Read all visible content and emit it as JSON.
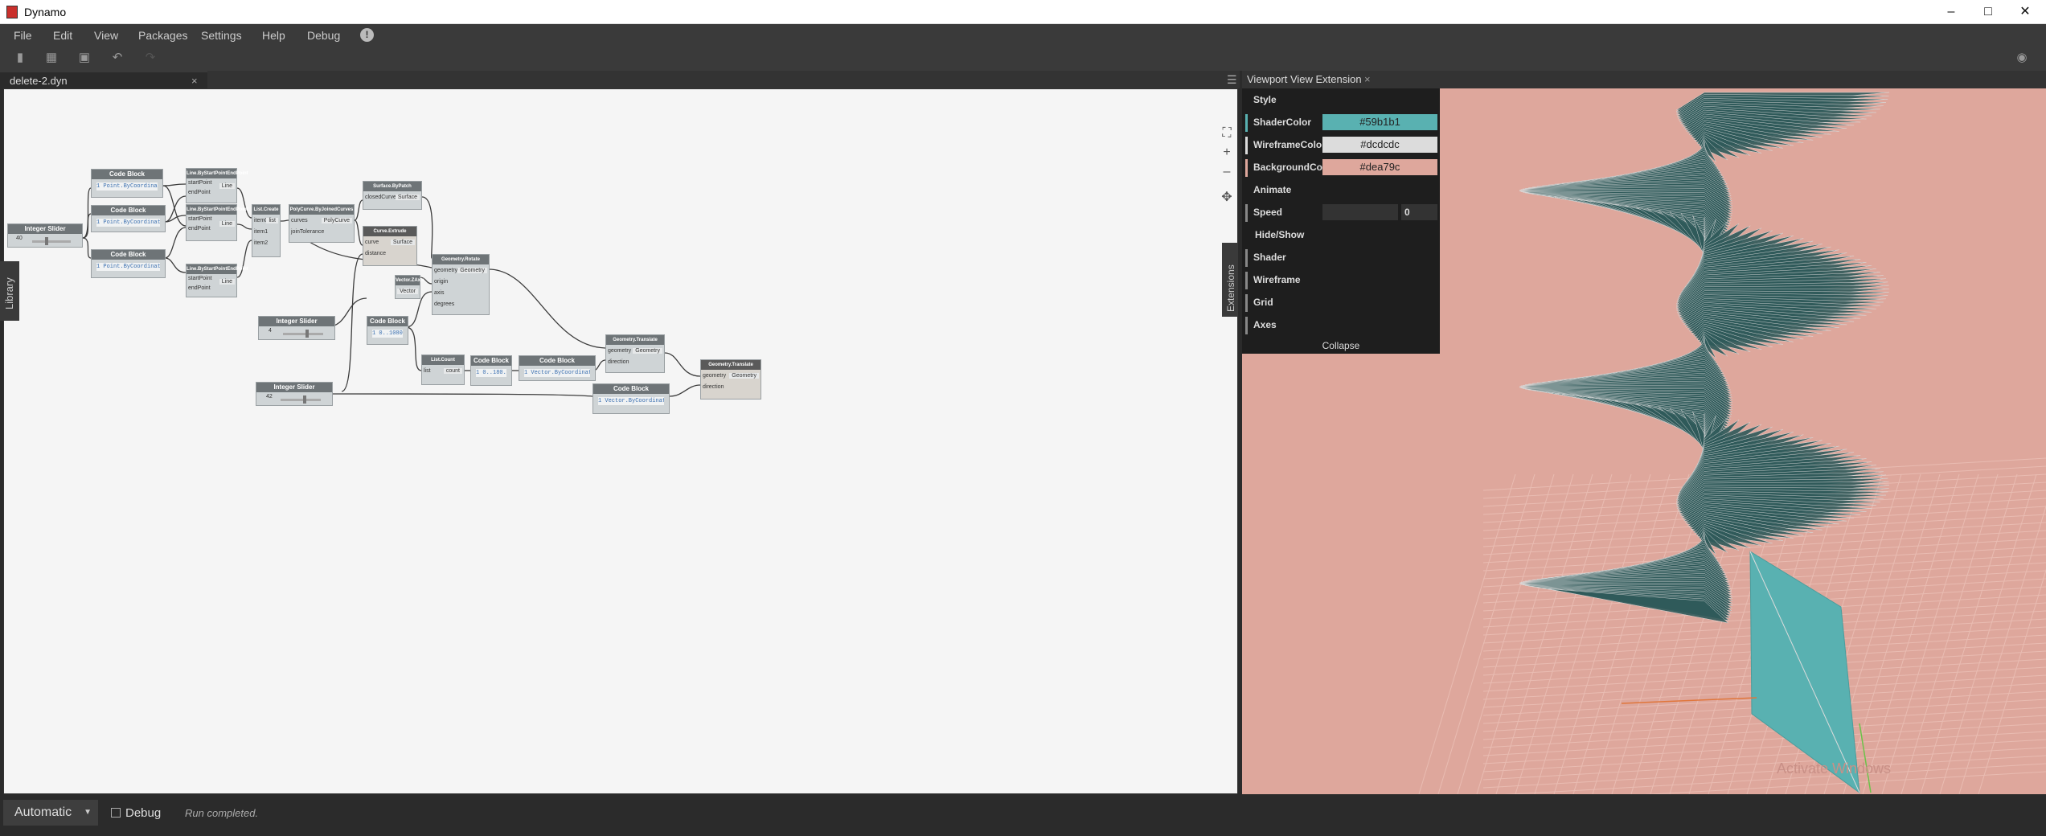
{
  "app": {
    "title": "Dynamo"
  },
  "menu": {
    "file": "File",
    "edit": "Edit",
    "view": "View",
    "packages": "Packages",
    "settings": "Settings",
    "help": "Help",
    "debug": "Debug",
    "info_icon": "!"
  },
  "tab": {
    "label": "delete-2.dyn",
    "close": "×"
  },
  "library": {
    "label": "Library"
  },
  "extensions": {
    "label": "Extensions"
  },
  "nodes": {
    "cb1": {
      "title": "Code Block",
      "code": "1 Point.ByCoordinates(1,5,0);"
    },
    "cb2": {
      "title": "Code Block",
      "code": "1 Point.ByCoordinates(1,5,0);"
    },
    "cb3": {
      "title": "Code Block",
      "code": "1 Point.ByCoordinates(1,1,0);"
    },
    "ln1": {
      "title": "Line.ByStartPointEndPoint",
      "in1": "startPoint",
      "in2": "endPoint",
      "out": "Line"
    },
    "ln2": {
      "title": "Line.ByStartPointEndPoint",
      "in1": "startPoint",
      "in2": "endPoint",
      "out": "Line"
    },
    "ln3": {
      "title": "Line.ByStartPointEndPoint",
      "in1": "startPoint",
      "in2": "endPoint",
      "out": "Line"
    },
    "is1": {
      "title": "Integer Slider",
      "value": "40"
    },
    "lc": {
      "title": "List.Create",
      "in1": "item0",
      "in2": "item1",
      "in3": "item2",
      "out": "list"
    },
    "pc": {
      "title": "PolyCurve.ByJoinedCurves",
      "in1": "curves",
      "in2": "joinTolerance",
      "out": "PolyCurve"
    },
    "sp": {
      "title": "Surface.ByPatch",
      "in1": "closedCurve",
      "out": "Surface"
    },
    "ce": {
      "title": "Curve.Extrude",
      "in1": "curve",
      "in2": "distance",
      "out": "Surface"
    },
    "vz": {
      "title": "Vector.ZAxis",
      "out": "Vector"
    },
    "gr": {
      "title": "Geometry.Rotate",
      "in1": "geometry",
      "in2": "origin",
      "in3": "axis",
      "in4": "degrees",
      "out": "Geometry"
    },
    "is2": {
      "title": "Integer Slider",
      "value": "4"
    },
    "cb4": {
      "title": "Code Block",
      "code": "1 0..1080..#;"
    },
    "is3": {
      "title": "Integer Slider",
      "value": "42"
    },
    "lcount": {
      "title": "List.Count",
      "in1": "list",
      "out": "count"
    },
    "cb5": {
      "title": "Code Block",
      "code": "1 0..180..#;"
    },
    "cb6": {
      "title": "Code Block",
      "code": "1 Vector.ByCoordinates(0,0,x);"
    },
    "gt1": {
      "title": "Geometry.Translate",
      "in1": "geometry",
      "in2": "direction",
      "out": "Geometry"
    },
    "cb7": {
      "title": "Code Block",
      "code": "1 Vector.ByCoordinates(0,0,x);"
    },
    "gt2": {
      "title": "Geometry.Translate",
      "in1": "geometry",
      "in2": "direction",
      "out": "Geometry"
    }
  },
  "viewport": {
    "header": "Viewport View Extension",
    "close": "×",
    "style": "Style",
    "shader_label": "ShaderColor",
    "shader_value": "#59b1b1",
    "wire_label": "WireframeColor",
    "wire_value": "#dcdcdc",
    "bg_label": "BackgroundColor",
    "bg_value": "#dea79c",
    "animate": "Animate",
    "speed_label": "Speed",
    "speed_value": "0",
    "hide_show": "Hide/Show",
    "shader": "Shader",
    "wireframe": "Wireframe",
    "grid": "Grid",
    "axes": "Axes",
    "collapse": "Collapse",
    "watermark": "Activate Windows"
  },
  "status": {
    "run_mode": "Automatic",
    "debug": "Debug",
    "message": "Run completed."
  },
  "colors": {
    "shader": "#59b1b1",
    "wireframe": "#dcdcdc",
    "background": "#dea79c",
    "helix_dark": "#2f5a5a"
  }
}
